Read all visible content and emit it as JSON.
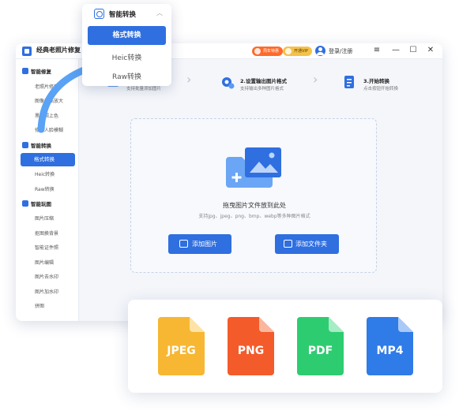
{
  "window": {
    "app_title": "经典老照片修复",
    "badges": {
      "anniversary": "周年特惠",
      "vip": "开通VIP"
    },
    "login": "登录/注册",
    "controls": {
      "menu": "≡",
      "minimize": "—",
      "maximize": "☐",
      "close": "✕"
    }
  },
  "sidebar": {
    "groups": [
      {
        "label": "智能修复",
        "items": [
          "老照片修复",
          "图像无损放大",
          "黑白照上色",
          "修复人脸模糊"
        ]
      },
      {
        "label": "智能转换",
        "items": [
          "格式转换",
          "Heic转换",
          "Raw转换"
        ]
      },
      {
        "label": "智能玩图",
        "items": [
          "图片压缩",
          "抠图换背景",
          "智能证件照",
          "图片编辑",
          "图片去水印",
          "图片加水印",
          "拼图"
        ]
      }
    ]
  },
  "steps": [
    {
      "title": "",
      "subtitle": "支持批量添加图片"
    },
    {
      "title": "2.设置输出图片格式",
      "subtitle": "支持输出多种图片格式"
    },
    {
      "title": "3.开始转换",
      "subtitle": "点击按钮开始转换"
    }
  ],
  "dropzone": {
    "title": "拖曳图片文件放到此处",
    "subtitle": "支持jpg、jpeg、png、bmp、webp等多种图片格式",
    "add_image": "添加图片",
    "add_folder": "添加文件夹"
  },
  "popup": {
    "title": "智能转换",
    "items": [
      "格式转换",
      "Heic转换",
      "Raw转换"
    ]
  },
  "formats": [
    {
      "label": "JPEG",
      "color": "#f7b733"
    },
    {
      "label": "PNG",
      "color": "#f45b2a"
    },
    {
      "label": "PDF",
      "color": "#2ecc71"
    },
    {
      "label": "MP4",
      "color": "#2f7be8"
    }
  ],
  "colors": {
    "accent": "#2f6fe0",
    "sidebar_active": "#2f6fe0"
  }
}
